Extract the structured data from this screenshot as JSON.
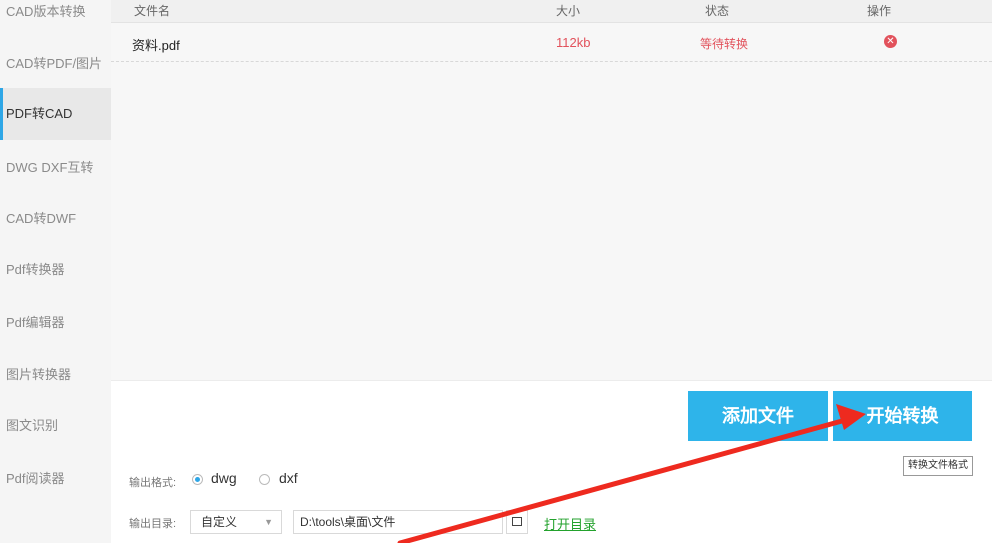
{
  "sidebar": {
    "items": [
      {
        "label": "CAD版本转换"
      },
      {
        "label": "CAD转PDF/图片"
      },
      {
        "label": "PDF转CAD"
      },
      {
        "label": "DWG DXF互转"
      },
      {
        "label": "CAD转DWF"
      },
      {
        "label": "Pdf转换器"
      },
      {
        "label": "Pdf编辑器"
      },
      {
        "label": "图片转换器"
      },
      {
        "label": "图文识别"
      },
      {
        "label": "Pdf阅读器"
      }
    ],
    "active_index": 2
  },
  "table": {
    "headers": {
      "name": "文件名",
      "size": "大小",
      "status": "状态",
      "action": "操作"
    },
    "rows": [
      {
        "name": "资料.pdf",
        "size": "112kb",
        "status": "等待转换",
        "action_icon": "delete-icon"
      }
    ]
  },
  "buttons": {
    "add": "添加文件",
    "start": "开始转换",
    "start_tooltip": "转换文件格式"
  },
  "output": {
    "format_label": "输出格式:",
    "format_options": [
      "dwg",
      "dxf"
    ],
    "format_selected": "dwg",
    "dir_label": "输出目录:",
    "dir_mode": "自定义",
    "dir_path": "D:\\tools\\桌面\\文件",
    "open_dir_link": "打开目录"
  },
  "colors": {
    "accent": "#2eb4ea",
    "status_red": "#e2525c",
    "link_green": "#23a22d",
    "arrow_red": "#ee2a1f"
  }
}
